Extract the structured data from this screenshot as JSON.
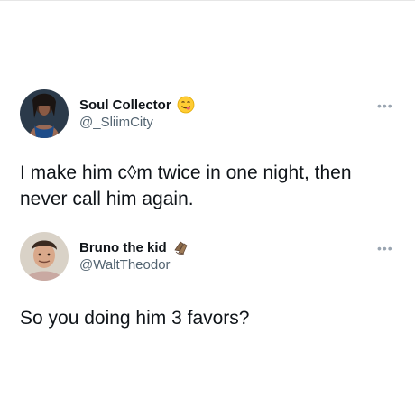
{
  "tweets": [
    {
      "display_name": "Soul Collector",
      "name_emoji": "savoring-face-emoji",
      "handle": "@_SliimCity",
      "more_label": "•••",
      "text_line1": "I make him c◊m twice in one night, then",
      "text_line2": "never call him again."
    },
    {
      "display_name": "Bruno the kid",
      "name_emoji": "clapping-hands-emoji",
      "handle": "@WaltTheodor",
      "more_label": "•••",
      "text_line1": "So you doing him 3 favors?"
    }
  ],
  "colors": {
    "text": "#0f1419",
    "secondary": "#536471",
    "divider": "#e6e6e6"
  }
}
